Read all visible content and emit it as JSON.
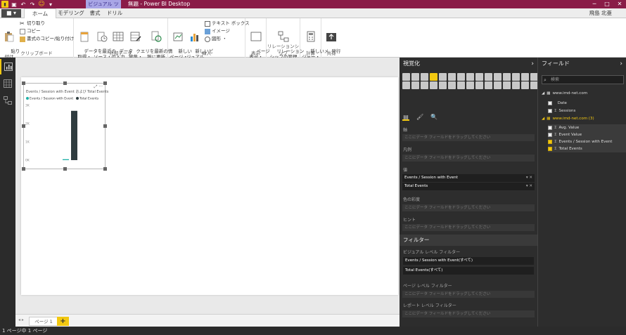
{
  "titlebar": {
    "context_tab": "ビジュアル ツール",
    "title": "無題 - Power BI Desktop",
    "min": "─",
    "max": "□",
    "close": "✕"
  },
  "tabs": {
    "file": "■ ▾",
    "items": [
      "ホーム",
      "モデリング",
      "書式",
      "ドリル"
    ],
    "user": "飛島 北亜"
  },
  "ribbon": {
    "clipboard": {
      "label": "クリップボード",
      "paste": "貼り\n付け",
      "cut": "切り取り",
      "copy": "コピー",
      "format_painter": "書式のコピー/貼り付け"
    },
    "external": {
      "label": "外部データ",
      "get_data": "データを\n取得・",
      "recent": "最近の\nソース・",
      "enter": "データ\nの入力",
      "edit_queries": "クエリを\n編集・",
      "refresh": "最新の情\n報に更新"
    },
    "insert": {
      "label": "挿入",
      "new_page": "新しい\nページ・",
      "new_visual": "新しいビ\nジュアル",
      "textbox": "テキスト ボックス",
      "image": "イメージ",
      "shapes": "図形 ・"
    },
    "view": {
      "label": "表示",
      "page_view": "ページ\n表示・"
    },
    "relations": {
      "label": "リレーションシップ",
      "manage": "リレーション\nシップの管理"
    },
    "calc": {
      "label": "計算",
      "new_measure": "新しいメ\nジャー・"
    },
    "share": {
      "label": "共有",
      "publish": "発行"
    }
  },
  "visual": {
    "title": "Events / Session with Event および Total Events",
    "legend": [
      {
        "name": "Events / Session with Event",
        "color": "#1eb0a6"
      },
      {
        "name": "Total Events",
        "color": "#2f3c3f"
      }
    ],
    "tools": "⤢ ···"
  },
  "chart_data": {
    "type": "bar",
    "categories": [
      ""
    ],
    "series": [
      {
        "name": "Events / Session with Event",
        "values": [
          0.05
        ]
      },
      {
        "name": "Total Events",
        "values": [
          2.7
        ]
      }
    ],
    "yticks": [
      "3K",
      "2K",
      "1K",
      "0K"
    ],
    "ylim": [
      0,
      3
    ],
    "colors": [
      "#1eb0a6",
      "#2f3c3f"
    ]
  },
  "pages": {
    "nav": "◂ ▸",
    "tab": "ページ 1",
    "add": "+"
  },
  "status": "1 ページ中 1 ページ",
  "viz_pane": {
    "title": "視覚化",
    "chev": "›",
    "icon_count": 30,
    "selected_index": 3,
    "tab_icons": [
      "▤",
      "🖌",
      "🔍"
    ],
    "wells": [
      {
        "label": "軸",
        "drop": "ここにデータ フィールドをドラッグしてください"
      },
      {
        "label": "凡例",
        "drop": "ここにデータ フィールドをドラッグしてください"
      },
      {
        "label": "値",
        "fields": [
          "Events / Session with Event",
          "Total Events"
        ]
      },
      {
        "label": "色の彩度",
        "drop": "ここにデータ フィールドをドラッグしてください"
      },
      {
        "label": "ヒント",
        "drop": "ここにデータ フィールドをドラッグしてください"
      }
    ],
    "field_ctrl": "▾ ✕",
    "filters": {
      "title": "フィルター",
      "visual_level": "ビジュアル レベル フィルター",
      "visual_items": [
        "Events / Session with Event(すべて)",
        "Total Events(すべて)"
      ],
      "page_level": "ページ レベル フィルター",
      "page_drop": "ここにデータ フィールドをドラッグしてください",
      "report_level": "レポート レベル フィルター",
      "report_drop": "ここにデータ フィールドをドラッグしてください"
    }
  },
  "fields_pane": {
    "title": "フィールド",
    "chev": "›",
    "search_placeholder": "検索",
    "tables": [
      {
        "name": "www.imd-net.com",
        "highlight": false,
        "fields": [
          {
            "name": "Date",
            "checked": false,
            "sigma": false
          },
          {
            "name": "Sessions",
            "checked": false,
            "sigma": true
          }
        ]
      },
      {
        "name": "www.imd-net.com (3)",
        "highlight": true,
        "fields": [
          {
            "name": "Avg. Value",
            "checked": false,
            "sigma": true
          },
          {
            "name": "Event Value",
            "checked": false,
            "sigma": true
          },
          {
            "name": "Events / Session with Event",
            "checked": true,
            "sigma": true
          },
          {
            "name": "Total Events",
            "checked": true,
            "sigma": true
          }
        ]
      }
    ]
  }
}
